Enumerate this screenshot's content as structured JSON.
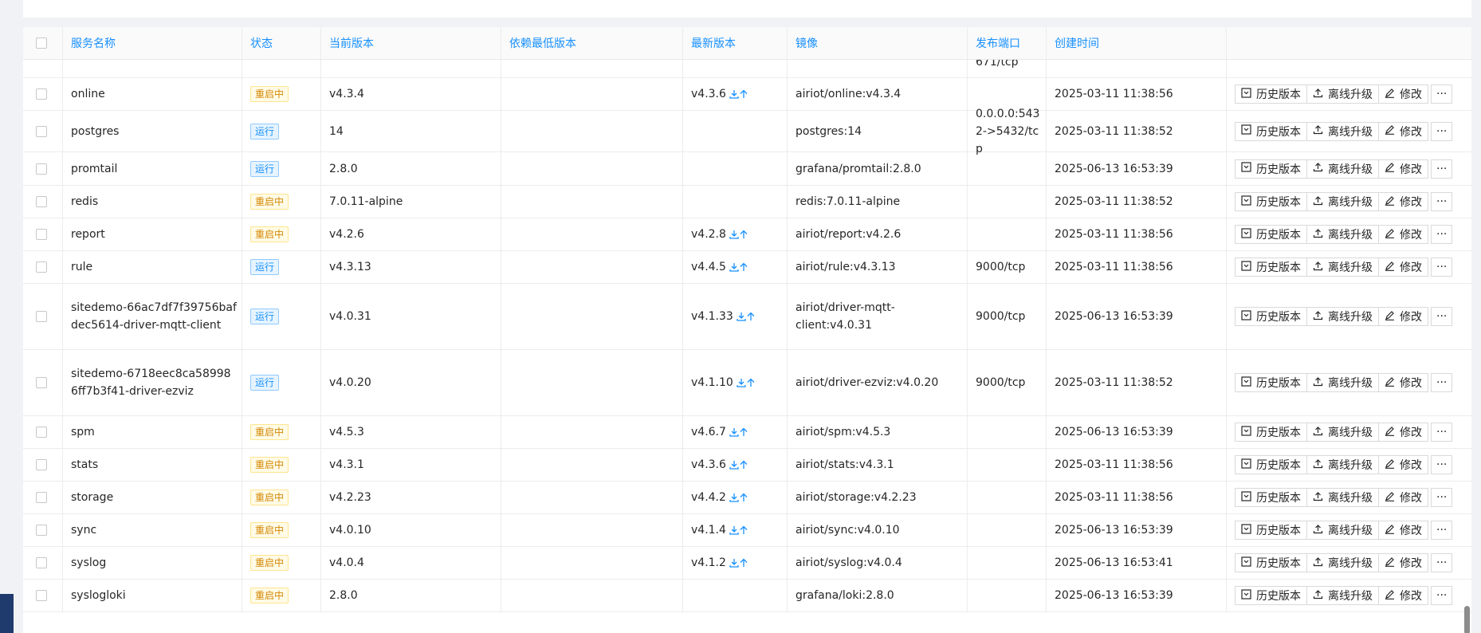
{
  "columns": {
    "name": "服务名称",
    "status": "状态",
    "current": "当前版本",
    "min_dep": "依赖最低版本",
    "latest": "最新版本",
    "image": "镜像",
    "port": "发布端口",
    "created": "创建时间"
  },
  "partial_top_port": "671/tcp",
  "status_labels": {
    "running": "运行",
    "restarting": "重启中"
  },
  "actions": {
    "history": "历史版本",
    "offline_upgrade": "离线升级",
    "edit": "修改",
    "more": "···"
  },
  "rows": [
    {
      "name": "online",
      "status": "重启中",
      "current": "v4.3.4",
      "latest": "v4.3.6",
      "image": "airiot/online:v4.3.4",
      "port": "",
      "created": "2025-03-11 11:38:56"
    },
    {
      "name": "postgres",
      "status": "运行",
      "current": "14",
      "latest": "",
      "image": "postgres:14",
      "port": "0.0.0.0:5432->5432/tcp",
      "created": "2025-03-11 11:38:52"
    },
    {
      "name": "promtail",
      "status": "运行",
      "current": "2.8.0",
      "latest": "",
      "image": "grafana/promtail:2.8.0",
      "port": "",
      "created": "2025-06-13 16:53:39"
    },
    {
      "name": "redis",
      "status": "重启中",
      "current": "7.0.11-alpine",
      "latest": "",
      "image": "redis:7.0.11-alpine",
      "port": "",
      "created": "2025-03-11 11:38:52"
    },
    {
      "name": "report",
      "status": "重启中",
      "current": "v4.2.6",
      "latest": "v4.2.8",
      "image": "airiot/report:v4.2.6",
      "port": "",
      "created": "2025-03-11 11:38:56"
    },
    {
      "name": "rule",
      "status": "运行",
      "current": "v4.3.13",
      "latest": "v4.4.5",
      "image": "airiot/rule:v4.3.13",
      "port": "9000/tcp",
      "created": "2025-03-11 11:38:56"
    },
    {
      "name": "sitedemo-66ac7df7f39756bafdec5614-driver-mqtt-client",
      "status": "运行",
      "current": "v4.0.31",
      "latest": "v4.1.33",
      "image": "airiot/driver-mqtt-client:v4.0.31",
      "port": "9000/tcp",
      "created": "2025-06-13 16:53:39"
    },
    {
      "name": "sitedemo-6718eec8ca589986ff7b3f41-driver-ezviz",
      "status": "运行",
      "current": "v4.0.20",
      "latest": "v4.1.10",
      "image": "airiot/driver-ezviz:v4.0.20",
      "port": "9000/tcp",
      "created": "2025-03-11 11:38:52"
    },
    {
      "name": "spm",
      "status": "重启中",
      "current": "v4.5.3",
      "latest": "v4.6.7",
      "image": "airiot/spm:v4.5.3",
      "port": "",
      "created": "2025-06-13 16:53:39"
    },
    {
      "name": "stats",
      "status": "重启中",
      "current": "v4.3.1",
      "latest": "v4.3.6",
      "image": "airiot/stats:v4.3.1",
      "port": "",
      "created": "2025-03-11 11:38:56"
    },
    {
      "name": "storage",
      "status": "重启中",
      "current": "v4.2.23",
      "latest": "v4.4.2",
      "image": "airiot/storage:v4.2.23",
      "port": "",
      "created": "2025-03-11 11:38:56"
    },
    {
      "name": "sync",
      "status": "重启中",
      "current": "v4.0.10",
      "latest": "v4.1.4",
      "image": "airiot/sync:v4.0.10",
      "port": "",
      "created": "2025-06-13 16:53:39"
    },
    {
      "name": "syslog",
      "status": "重启中",
      "current": "v4.0.4",
      "latest": "v4.1.2",
      "image": "airiot/syslog:v4.0.4",
      "port": "",
      "created": "2025-06-13 16:53:41"
    },
    {
      "name": "syslogloki",
      "status": "重启中",
      "current": "2.8.0",
      "latest": "",
      "image": "grafana/loki:2.8.0",
      "port": "",
      "created": "2025-06-13 16:53:39"
    }
  ],
  "colors": {
    "accent": "#1890ff",
    "running_bg": "#e6f4ff",
    "restarting_fg": "#d48806",
    "restarting_bg": "#fffbe6"
  },
  "icons": {
    "history": "history-icon",
    "upload": "upload-icon",
    "edit": "edit-icon",
    "download": "download-icon",
    "arrow_up": "arrow-up-icon"
  }
}
